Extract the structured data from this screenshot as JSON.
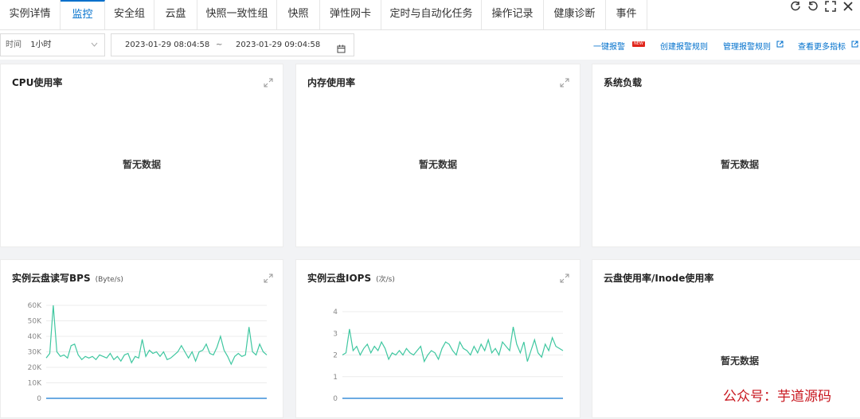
{
  "tabs": [
    {
      "label": "实例详情"
    },
    {
      "label": "监控",
      "active": true
    },
    {
      "label": "安全组"
    },
    {
      "label": "云盘"
    },
    {
      "label": "快照一致性组"
    },
    {
      "label": "快照"
    },
    {
      "label": "弹性网卡"
    },
    {
      "label": "定时与自动化任务"
    },
    {
      "label": "操作记录"
    },
    {
      "label": "健康诊断"
    },
    {
      "label": "事件"
    }
  ],
  "window_icons": [
    "refresh-icon",
    "refresh-alt-icon",
    "fullscreen-icon",
    "close-icon"
  ],
  "toolbar": {
    "time_label": "时间",
    "time_value": "1小时",
    "range_start": "2023-01-29 08:04:58",
    "range_tilde": "~",
    "range_end": "2023-01-29 09:04:58",
    "one_click_alert": "一键报警",
    "new_badge": "NEW",
    "create_rule": "创建报警规则",
    "manage_rule": "管理报警规则",
    "more_metrics": "查看更多指标"
  },
  "cards": {
    "cpu": {
      "title": "CPU使用率",
      "nodata": "暂无数据"
    },
    "memory": {
      "title": "内存使用率",
      "nodata": "暂无数据"
    },
    "load": {
      "title": "系统负载",
      "nodata": "暂无数据"
    },
    "disk_bps": {
      "title": "实例云盘读写BPS",
      "unit": "(Byte/s)"
    },
    "disk_iops": {
      "title": "实例云盘IOPS",
      "unit": "(次/s)"
    },
    "disk_usage": {
      "title": "云盘使用率/Inode使用率",
      "nodata": "暂无数据"
    }
  },
  "chart_data": [
    {
      "type": "line",
      "title": "实例云盘读写BPS",
      "yticks": [
        "0",
        "10K",
        "20K",
        "30K",
        "40K",
        "50K",
        "60K"
      ],
      "ylim": [
        0,
        60000
      ],
      "colors": {
        "read": "#3fc7a0",
        "write": "#3a8fd8"
      },
      "series": [
        {
          "values": [
            26000,
            29000,
            60000,
            30000,
            27000,
            28000,
            26000,
            34000,
            35000,
            28000,
            25000,
            27000,
            26000,
            27000,
            25000,
            28000,
            27000,
            26000,
            29000,
            25000,
            27000,
            24000,
            28000,
            29000,
            23000,
            27000,
            26000,
            38000,
            27000,
            31000,
            29000,
            30000,
            27000,
            30000,
            25000,
            26000,
            28000,
            30000,
            34000,
            30000,
            26000,
            30000,
            24000,
            30000,
            31000,
            35000,
            29000,
            28000,
            33000,
            40000,
            31000,
            27000,
            22000,
            27000,
            29000,
            27000,
            28000,
            46000,
            30000,
            28000,
            35000,
            30000,
            28000
          ]
        },
        {
          "values": [
            0,
            0,
            0,
            0,
            0,
            0,
            0,
            0,
            0,
            0,
            0,
            0,
            0,
            0,
            0,
            0,
            0,
            0,
            0,
            0,
            0,
            0,
            0,
            0,
            0,
            0,
            0,
            0,
            0,
            0,
            0,
            0,
            0,
            0,
            0,
            0,
            0,
            0,
            0,
            0,
            0,
            0,
            0,
            0,
            0,
            0,
            0,
            0,
            0,
            0,
            0,
            0,
            0,
            0,
            0,
            0,
            0,
            0,
            0,
            0,
            0,
            0,
            0
          ]
        }
      ]
    },
    {
      "type": "line",
      "title": "实例云盘IOPS",
      "yticks": [
        "0",
        "1",
        "2",
        "3",
        "4"
      ],
      "ylim": [
        0,
        4
      ],
      "colors": {
        "read": "#3fc7a0",
        "write": "#3a8fd8"
      },
      "series": [
        {
          "values": [
            2.0,
            2.1,
            3.2,
            2.2,
            2.4,
            2.0,
            2.3,
            2.5,
            2.1,
            2.4,
            2.2,
            2.6,
            2.3,
            1.8,
            2.1,
            2.0,
            2.2,
            2.0,
            2.3,
            2.1,
            2.0,
            2.2,
            2.4,
            1.7,
            2.0,
            2.2,
            2.1,
            1.8,
            2.3,
            2.6,
            2.5,
            2.2,
            2.0,
            2.6,
            2.3,
            2.2,
            2.0,
            2.4,
            2.1,
            2.5,
            2.2,
            2.7,
            2.1,
            2.3,
            2.0,
            2.6,
            2.4,
            2.2,
            3.3,
            2.5,
            2.1,
            2.6,
            1.7,
            2.2,
            2.7,
            2.1,
            1.9,
            2.5,
            2.2,
            2.8,
            2.4,
            2.3,
            2.2
          ]
        },
        {
          "values": [
            0,
            0,
            0,
            0,
            0,
            0,
            0,
            0,
            0,
            0,
            0,
            0,
            0,
            0,
            0,
            0,
            0,
            0,
            0,
            0,
            0,
            0,
            0,
            0,
            0,
            0,
            0,
            0,
            0,
            0,
            0,
            0,
            0,
            0,
            0,
            0,
            0,
            0,
            0,
            0,
            0,
            0,
            0,
            0,
            0,
            0,
            0,
            0,
            0,
            0,
            0,
            0,
            0,
            0,
            0,
            0,
            0,
            0,
            0,
            0,
            0,
            0,
            0
          ]
        }
      ]
    }
  ],
  "watermark": "公众号：芋道源码"
}
